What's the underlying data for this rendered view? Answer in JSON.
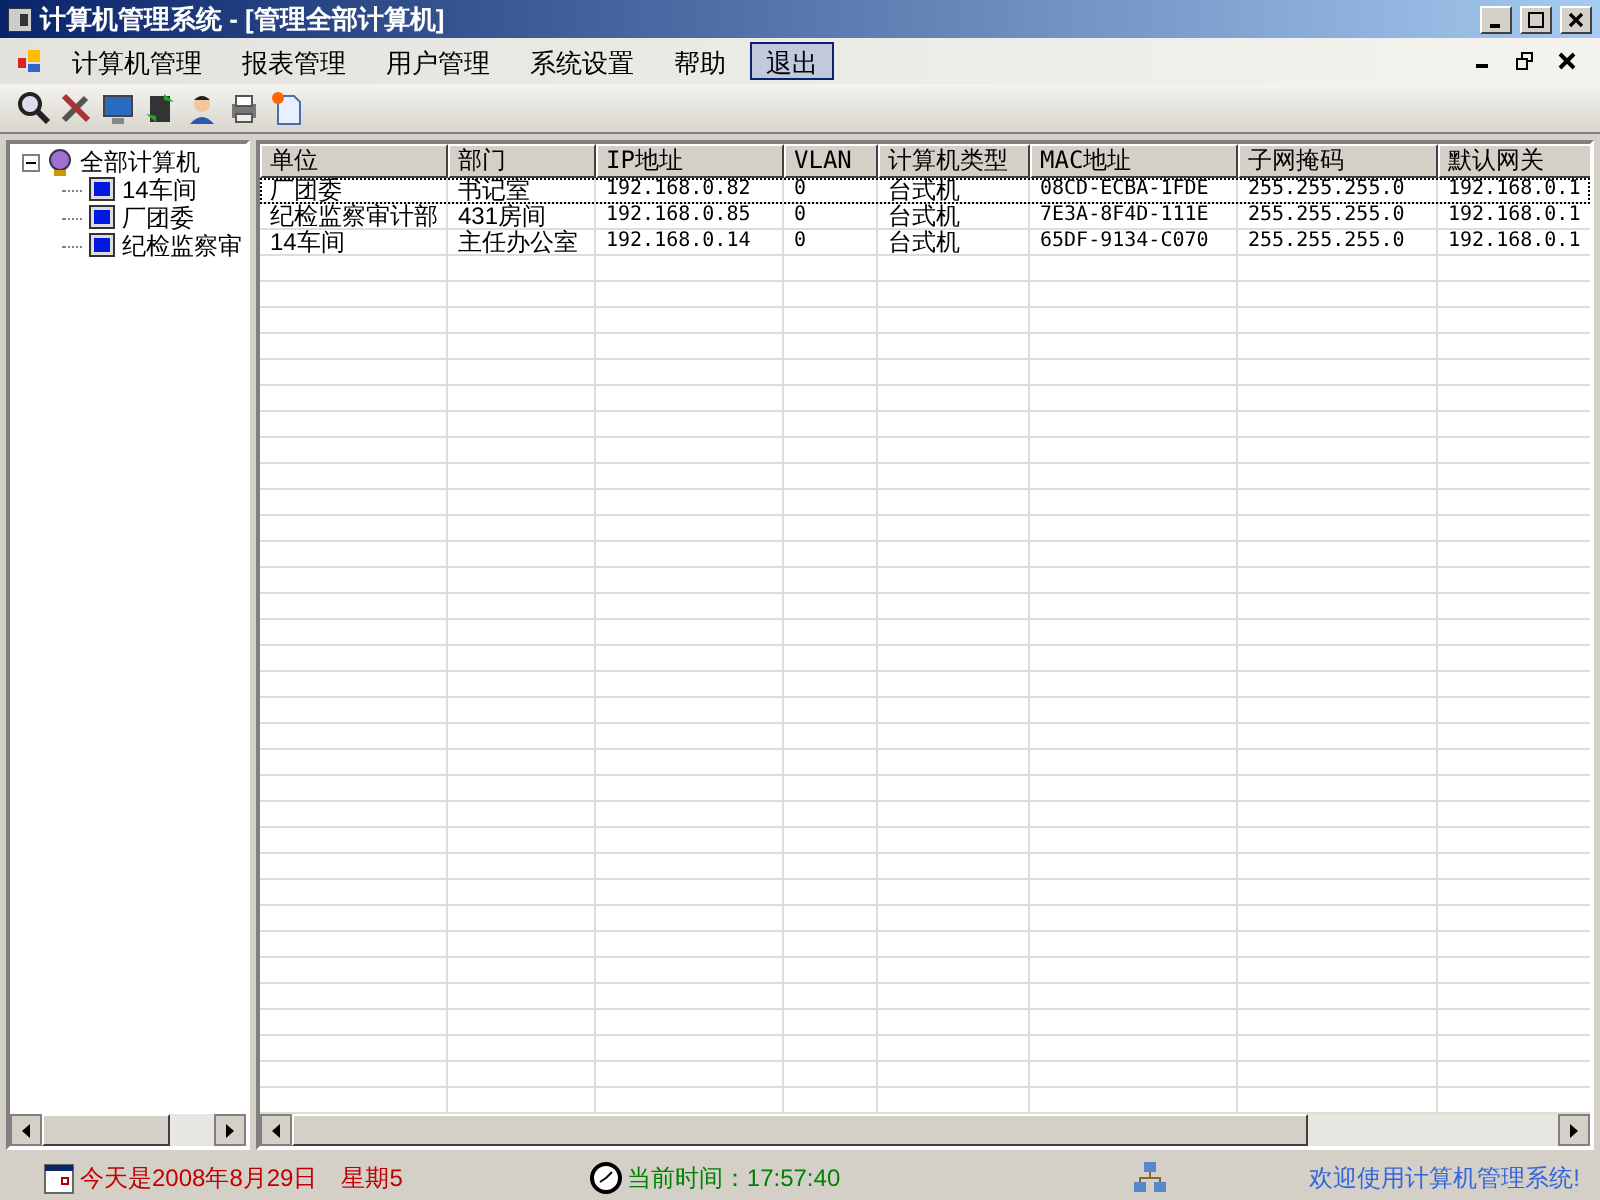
{
  "window": {
    "title": "计算机管理系统 - [管理全部计算机]"
  },
  "menu": [
    {
      "label": "计算机管理",
      "selected": false
    },
    {
      "label": "报表管理",
      "selected": false
    },
    {
      "label": "用户管理",
      "selected": false
    },
    {
      "label": "系统设置",
      "selected": false
    },
    {
      "label": "帮助",
      "selected": false
    },
    {
      "label": "退出",
      "selected": true
    }
  ],
  "tree": [
    {
      "label": "全部计算机",
      "expanded": true,
      "children": [
        {
          "label": "14车间"
        },
        {
          "label": "厂团委"
        },
        {
          "label": "纪检监察审"
        }
      ]
    }
  ],
  "table": {
    "columns": [
      "单位",
      "部门",
      "IP地址",
      "VLAN",
      "计算机类型",
      "MAC地址",
      "子网掩码",
      "默认网关"
    ],
    "rows": [
      {
        "selected": true,
        "cells": [
          "厂团委",
          "书记室",
          "192.168.0.82",
          "0",
          "台式机",
          "08CD-ECBA-1FDE",
          "255.255.255.0",
          "192.168.0.1"
        ]
      },
      {
        "selected": false,
        "cells": [
          "纪检监察审计部",
          "431房间",
          "192.168.0.85",
          "0",
          "台式机",
          "7E3A-8F4D-111E",
          "255.255.255.0",
          "192.168.0.1"
        ]
      },
      {
        "selected": false,
        "cells": [
          "14车间",
          "主任办公室",
          "192.168.0.14",
          "0",
          "台式机",
          "65DF-9134-C070",
          "255.255.255.0",
          "192.168.0.1"
        ]
      }
    ]
  },
  "status_bar": {
    "date": "今天是2008年8月29日",
    "weekday": "星期5",
    "time": "当前时间：17:57:40",
    "welcome": "欢迎使用计算机管理系统!"
  }
}
